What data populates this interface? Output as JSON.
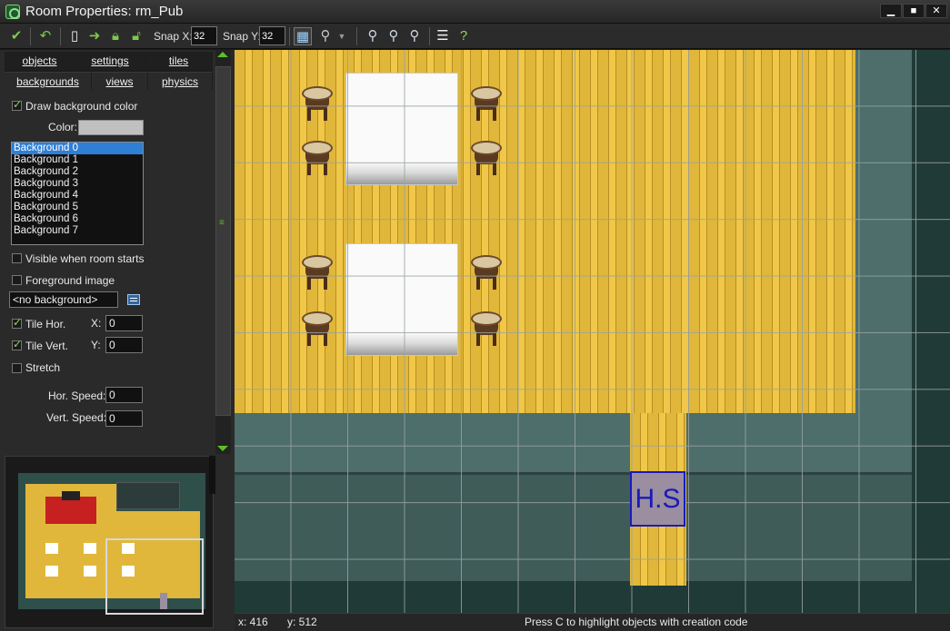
{
  "window": {
    "title": "Room Properties: rm_Pub",
    "min": "▁",
    "max": "■",
    "close": "✕"
  },
  "toolbar": {
    "snap_x_label": "Snap X:",
    "snap_x_value": "32",
    "snap_y_label": "Snap Y:",
    "snap_y_value": "32"
  },
  "tabs": {
    "objects": "objects",
    "settings": "settings",
    "tiles": "tiles",
    "backgrounds": "backgrounds",
    "views": "views",
    "physics": "physics"
  },
  "backgrounds_panel": {
    "draw_bg_color_label": "Draw background color",
    "color_label": "Color:",
    "list": [
      "Background 0",
      "Background 1",
      "Background 2",
      "Background 3",
      "Background 4",
      "Background 5",
      "Background 6",
      "Background 7"
    ],
    "visible_label": "Visible when room starts",
    "foreground_label": "Foreground image",
    "background_select_value": "<no background>",
    "tile_hor_label": "Tile Hor.",
    "tile_vert_label": "Tile Vert.",
    "x_label": "X:",
    "x_value": "0",
    "y_label": "Y:",
    "y_value": "0",
    "stretch_label": "Stretch",
    "hor_speed_label": "Hor. Speed:",
    "hor_speed_value": "0",
    "vert_speed_label": "Vert. Speed:",
    "vert_speed_value": "0"
  },
  "room": {
    "object_label": "H.S"
  },
  "status": {
    "x": "x: 416",
    "y": "y: 512",
    "hint": "Press C to highlight objects with creation code"
  }
}
